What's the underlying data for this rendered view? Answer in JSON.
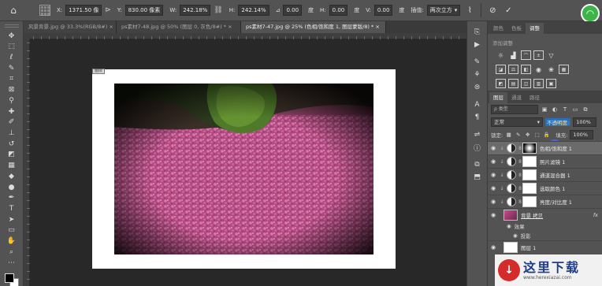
{
  "options_bar": {
    "x_label": "X:",
    "x_value": "1371.50 像",
    "link_symbol": "⊳",
    "y_label": "Y:",
    "y_value": "830.00 像素",
    "w_label": "W:",
    "w_value": "242.18%",
    "h_label": "H:",
    "h_value": "242.14%",
    "angle_value": "0.00",
    "angle_unit": "度",
    "hskew_label": "H:",
    "hskew_value": "0.00",
    "hskew_unit": "度",
    "vskew_label": "V:",
    "vskew_value": "0.00",
    "vskew_unit": "度",
    "interp_label": "插值:",
    "interp_value": "两次立方",
    "cancel_icon": "cancel-icon",
    "commit_icon": "commit-check-icon"
  },
  "document_tabs": [
    {
      "label": "风景背景.jpg @ 33.3%(RGB/8#) ×"
    },
    {
      "label": "ps素材7-48.jpg @ 50% (图层 0, 灰色/8#) * ×"
    },
    {
      "label": "ps素材7-47.jpg @ 25% (色相/饱和度 1, 图层蒙版/8) * ×"
    }
  ],
  "right_panel": {
    "top_tabs": [
      "颜色",
      "色板",
      "调整"
    ],
    "adjust_title": "添加调整",
    "layers_tabs": [
      "图层",
      "通道",
      "路径"
    ],
    "search_placeholder": "ρ 类型",
    "blend_mode": "正常",
    "opacity_label": "不透明度:",
    "opacity_value": "100%",
    "lock_label": "锁定:",
    "fill_label": "填充:",
    "fill_value": "100%",
    "layers": [
      {
        "name": "色相/饱和度 1",
        "mask": "dark"
      },
      {
        "name": "照片滤镜 1",
        "mask": "light"
      },
      {
        "name": "通道混合器 1",
        "mask": "light"
      },
      {
        "name": "选取颜色 1",
        "mask": "light"
      },
      {
        "name": "亮度/对比度 1",
        "mask": "light"
      }
    ],
    "bg_layer": {
      "name": "背景 拷贝",
      "fx": "fx"
    },
    "effects_label": "效果",
    "shadow_label": "投影",
    "bottom_layer": {
      "name": "图层 1"
    }
  },
  "watermark": {
    "title": "这里下载",
    "url": "www.herexiazai.com",
    "logo": "↓"
  },
  "paper_tag": "图层",
  "colors": {
    "accent_green": "#3cb44a",
    "cursor_blue": "#4c6ee6",
    "flower_pink": "#c84b8e"
  }
}
